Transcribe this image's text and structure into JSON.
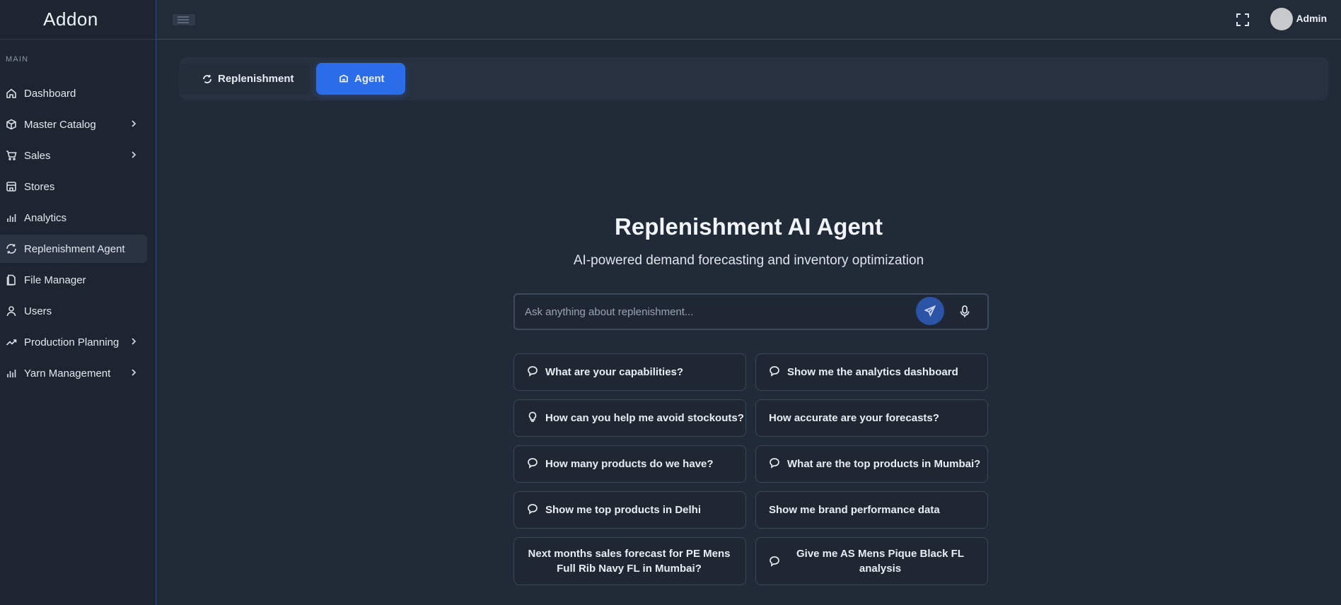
{
  "sidebar": {
    "brand": "Addon",
    "section_label": "MAIN",
    "items": [
      {
        "label": "Dashboard"
      },
      {
        "label": "Master Catalog"
      },
      {
        "label": "Sales"
      },
      {
        "label": "Stores"
      },
      {
        "label": "Analytics"
      },
      {
        "label": "Replenishment Agent"
      },
      {
        "label": "File Manager"
      },
      {
        "label": "Users"
      },
      {
        "label": "Production Planning"
      },
      {
        "label": "Yarn Management"
      }
    ]
  },
  "topbar": {
    "user_name": "Admin"
  },
  "tabs": [
    {
      "label": "Replenishment"
    },
    {
      "label": "Agent"
    }
  ],
  "hero": {
    "title": "Replenishment AI Agent",
    "subtitle": "AI-powered demand forecasting and inventory optimization"
  },
  "search": {
    "placeholder": "Ask anything about replenishment...",
    "value": ""
  },
  "suggestions": [
    {
      "label": "What are your capabilities?",
      "icon": "message-circle-icon"
    },
    {
      "label": "Show me the analytics dashboard",
      "icon": "message-circle-icon"
    },
    {
      "label": "How can you help me avoid stockouts?",
      "icon": "lightbulb-icon"
    },
    {
      "label": "How accurate are your forecasts?",
      "icon": ""
    },
    {
      "label": "How many products do we have?",
      "icon": "message-circle-icon"
    },
    {
      "label": "What are the top products in Mumbai?",
      "icon": "message-circle-icon"
    },
    {
      "label": "Show me top products in Delhi",
      "icon": "message-circle-icon"
    },
    {
      "label": "Show me brand performance data",
      "icon": ""
    },
    {
      "label": "Next months sales forecast for PE Mens Full Rib Navy FL in Mumbai?",
      "icon": ""
    },
    {
      "label": "Give me AS Mens Pique Black FL analysis",
      "icon": "message-circle-icon"
    }
  ],
  "colors": {
    "accent": "#2b6de8",
    "background": "#212a37",
    "sidebar": "#1d2531"
  }
}
